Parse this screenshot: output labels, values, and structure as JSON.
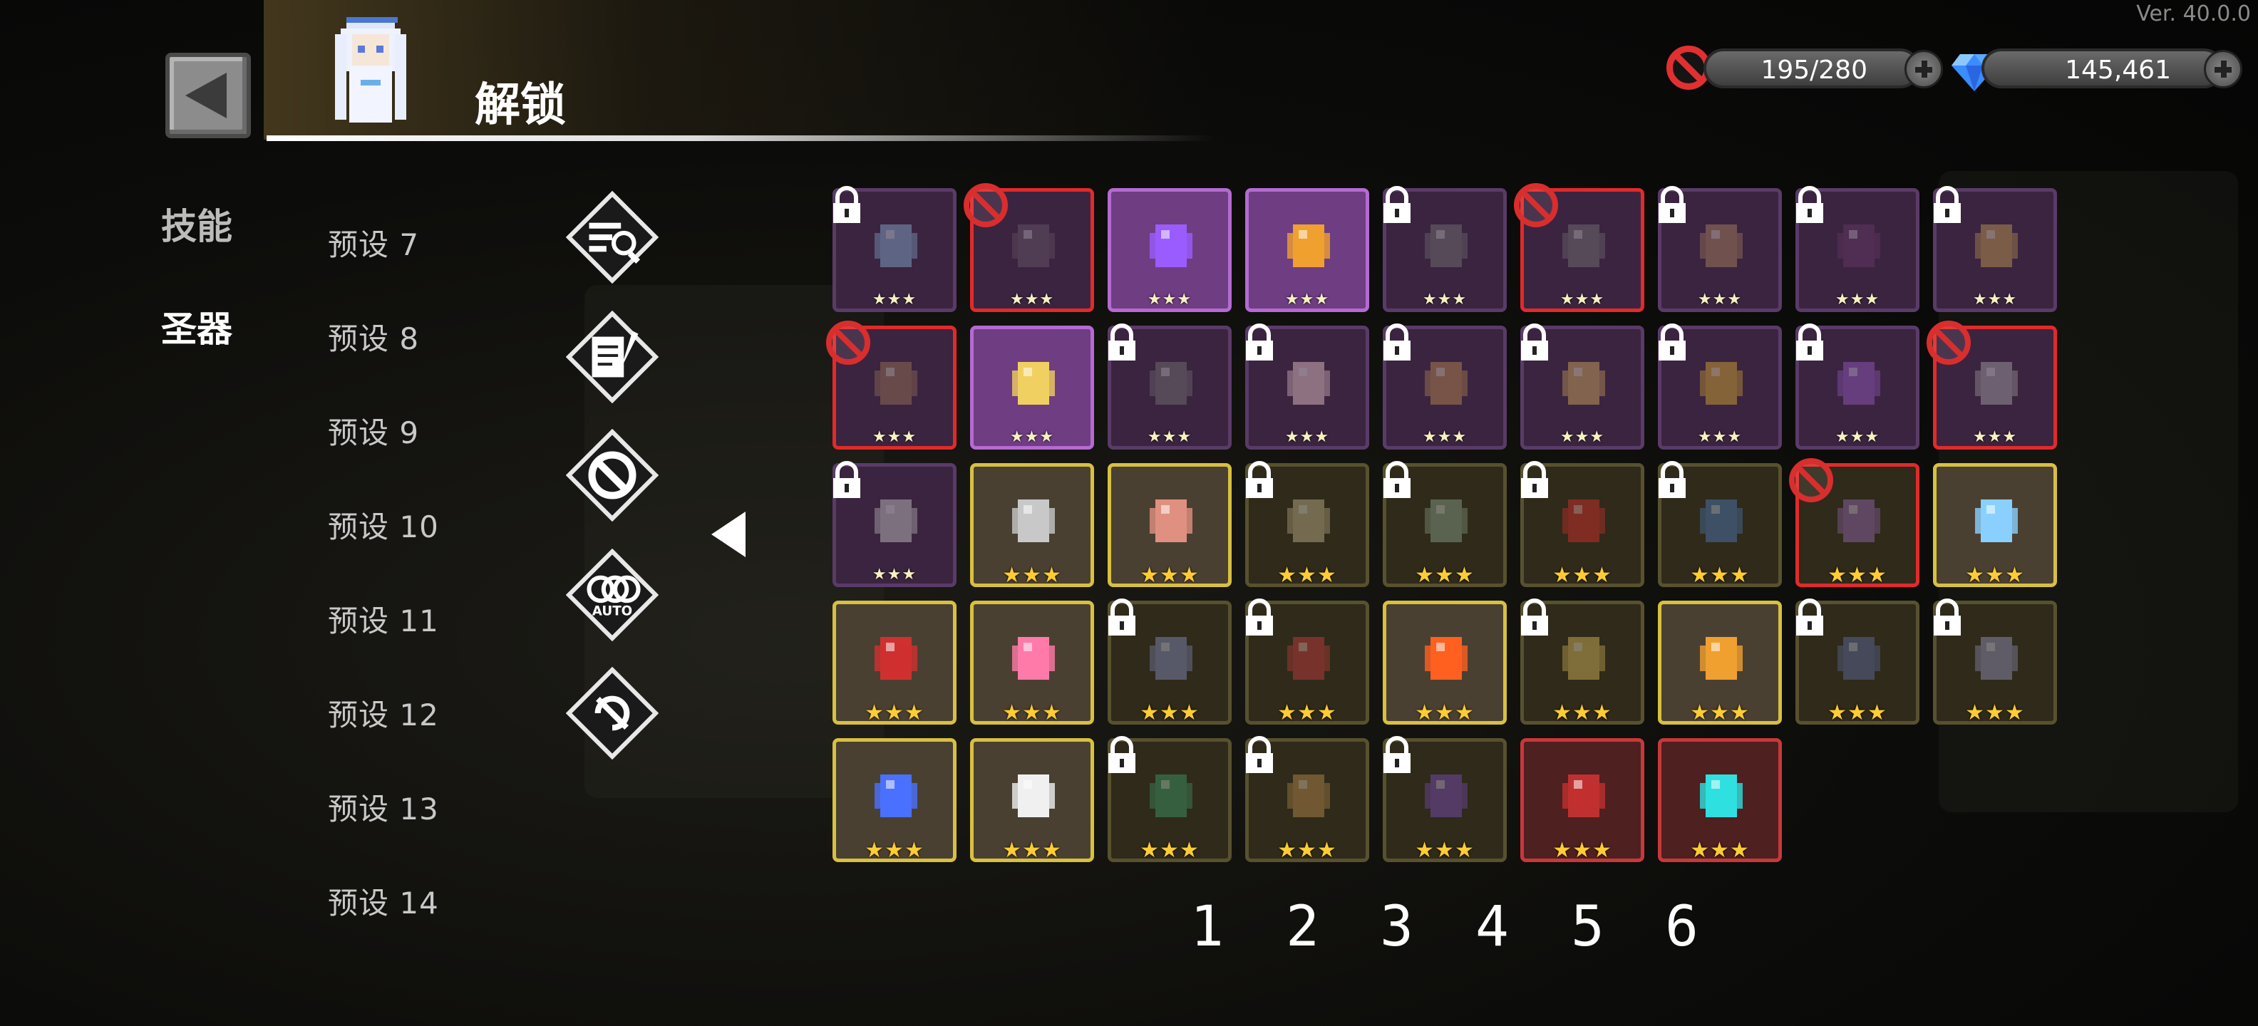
{
  "version": "Ver. 40.0.0",
  "header": {
    "title": "解锁"
  },
  "resources": {
    "blocked_count": "195/280",
    "gems": "145,461"
  },
  "side_tabs": [
    {
      "label": "技能",
      "active": false
    },
    {
      "label": "圣器",
      "active": true
    }
  ],
  "presets": [
    "预设 7",
    "预设 8",
    "预设 9",
    "预设 10",
    "预设 11",
    "预设 12",
    "预设 13",
    "预设 14"
  ],
  "filters": [
    {
      "icon": "search-filter-icon"
    },
    {
      "icon": "scroll-quill-icon"
    },
    {
      "icon": "ban-filter-icon"
    },
    {
      "icon": "auto-icon",
      "label": "AUTO"
    },
    {
      "icon": "no-auto-icon"
    }
  ],
  "grid": {
    "rows": [
      [
        {
          "name": "cloud-orb-relic",
          "rarity": "purple",
          "stars": "★★★",
          "locked": true,
          "dim": true,
          "color": "#8ab4d8"
        },
        {
          "name": "broken-frame-relic",
          "rarity": "purple",
          "stars": "★★★",
          "banned": true,
          "dim": true,
          "color": "#6a5a6a"
        },
        {
          "name": "amethyst-relic",
          "rarity": "purple",
          "bright": true,
          "stars": "★★★",
          "color": "#9a5cff"
        },
        {
          "name": "medal-relic",
          "rarity": "purple",
          "bright": true,
          "stars": "★★★",
          "color": "#f0a030"
        },
        {
          "name": "feather-quill-relic",
          "rarity": "purple",
          "stars": "★★★",
          "locked": true,
          "dim": true,
          "color": "#777"
        },
        {
          "name": "dark-armor-relic",
          "rarity": "purple",
          "stars": "★★★",
          "banned": true,
          "dim": true,
          "color": "#777"
        },
        {
          "name": "treasure-chest-relic",
          "rarity": "purple",
          "stars": "★★★",
          "locked": true,
          "dim": true,
          "color": "#b08860"
        },
        {
          "name": "dark-claw-relic",
          "rarity": "purple",
          "stars": "★★★",
          "locked": true,
          "dim": true,
          "color": "#6a3a6a"
        },
        {
          "name": "gear-relic",
          "rarity": "purple",
          "stars": "★★★",
          "locked": true,
          "dim": true,
          "color": "#c8a050"
        }
      ],
      [
        {
          "name": "pouch-relic",
          "rarity": "purple",
          "stars": "★★★",
          "banned": true,
          "dim": true,
          "color": "#a07a5a"
        },
        {
          "name": "crossed-swords-relic",
          "rarity": "purple",
          "bright": true,
          "stars": "★★★",
          "color": "#f0d060"
        },
        {
          "name": "goggles-relic",
          "rarity": "purple",
          "stars": "★★★",
          "locked": true,
          "dim": true,
          "color": "#777"
        },
        {
          "name": "cake-relic",
          "rarity": "purple",
          "stars": "★★★",
          "locked": true,
          "dim": true,
          "color": "#f0d0d0"
        },
        {
          "name": "rune-block-relic",
          "rarity": "purple",
          "stars": "★★★",
          "locked": true,
          "dim": true,
          "color": "#c09050"
        },
        {
          "name": "ankh-relic",
          "rarity": "purple",
          "stars": "★★★",
          "locked": true,
          "dim": true,
          "color": "#d8b060"
        },
        {
          "name": "bell-relic",
          "rarity": "purple",
          "stars": "★★★",
          "locked": true,
          "dim": true,
          "color": "#e0b030"
        },
        {
          "name": "dagger-relic",
          "rarity": "purple",
          "stars": "★★★",
          "locked": true,
          "dim": true,
          "color": "#9a5cc8"
        },
        {
          "name": "scroll-relic",
          "rarity": "purple",
          "stars": "★★★",
          "banned": true,
          "dim": true,
          "color": "#aaa"
        }
      ],
      [
        {
          "name": "feather-relic",
          "rarity": "purple",
          "stars": "★★★",
          "locked": true,
          "dim": true,
          "color": "#ccc"
        },
        {
          "name": "tombstone-relic",
          "rarity": "gold",
          "bright": true,
          "stars": "★★★",
          "color": "#c8c8c8"
        },
        {
          "name": "branch-relic",
          "rarity": "gold",
          "bright": true,
          "stars": "★★★",
          "color": "#e09080"
        },
        {
          "name": "skull-relic",
          "rarity": "gold",
          "stars": "★★★",
          "locked": true,
          "dim": true,
          "color": "#c8b890"
        },
        {
          "name": "barrel-relic",
          "rarity": "gold",
          "stars": "★★★",
          "locked": true,
          "dim": true,
          "color": "#90a890"
        },
        {
          "name": "ring-relic",
          "rarity": "gold",
          "stars": "★★★",
          "locked": true,
          "dim": true,
          "color": "#e03030"
        },
        {
          "name": "book-stack-relic",
          "rarity": "gold",
          "stars": "★★★",
          "locked": true,
          "dim": true,
          "color": "#5080c0"
        },
        {
          "name": "purple-hat-relic",
          "rarity": "gold",
          "stars": "★★★",
          "banned": true,
          "dim": true,
          "color": "#9a6ab8"
        },
        {
          "name": "ice-antler-relic",
          "rarity": "gold",
          "bright": true,
          "stars": "★★★",
          "color": "#8ad0ff"
        }
      ],
      [
        {
          "name": "red-gauntlet-relic",
          "rarity": "gold",
          "bright": true,
          "stars": "★★★",
          "color": "#d03030"
        },
        {
          "name": "potion-flask-relic",
          "rarity": "gold",
          "bright": true,
          "stars": "★★★",
          "color": "#ff7aa8"
        },
        {
          "name": "dark-globe-relic",
          "rarity": "gold",
          "stars": "★★★",
          "locked": true,
          "dim": true,
          "color": "#8890c8"
        },
        {
          "name": "red-sword-relic",
          "rarity": "gold",
          "stars": "★★★",
          "locked": true,
          "dim": true,
          "color": "#d04040"
        },
        {
          "name": "flame-sword-relic",
          "rarity": "gold",
          "bright": true,
          "stars": "★★★",
          "color": "#ff6020"
        },
        {
          "name": "dice-relic",
          "rarity": "gold",
          "stars": "★★★",
          "locked": true,
          "dim": true,
          "color": "#e0c060"
        },
        {
          "name": "golden-key-relic",
          "rarity": "gold",
          "bright": true,
          "stars": "★★★",
          "color": "#f0a030"
        },
        {
          "name": "spellbook-relic",
          "rarity": "gold",
          "stars": "★★★",
          "locked": true,
          "dim": true,
          "color": "#6070a8"
        },
        {
          "name": "claw-slash-relic",
          "rarity": "gold",
          "stars": "★★★",
          "locked": true,
          "dim": true,
          "color": "#9a9ac8"
        }
      ],
      [
        {
          "name": "blue-crystal-relic",
          "rarity": "gold",
          "bright": true,
          "stars": "★★★",
          "color": "#4a70ff"
        },
        {
          "name": "clock-egg-relic",
          "rarity": "gold",
          "bright": true,
          "stars": "★★★",
          "color": "#f0f0f0"
        },
        {
          "name": "green-gourd-relic",
          "rarity": "gold",
          "stars": "★★★",
          "locked": true,
          "dim": true,
          "color": "#40a070"
        },
        {
          "name": "stag-relic",
          "rarity": "gold",
          "stars": "★★★",
          "locked": true,
          "dim": true,
          "color": "#c09050"
        },
        {
          "name": "purple-lantern-relic",
          "rarity": "gold",
          "stars": "★★★",
          "locked": true,
          "dim": true,
          "color": "#8050c0"
        },
        {
          "name": "red-dagger-relic",
          "rarity": "red",
          "bright": true,
          "stars": "★★★",
          "color": "#c03030"
        },
        {
          "name": "cyan-flame-relic",
          "rarity": "red",
          "bright": true,
          "stars": "★★★",
          "color": "#30e0e0"
        }
      ]
    ]
  },
  "numbers": [
    "1",
    "2",
    "3",
    "4",
    "5",
    "6"
  ]
}
